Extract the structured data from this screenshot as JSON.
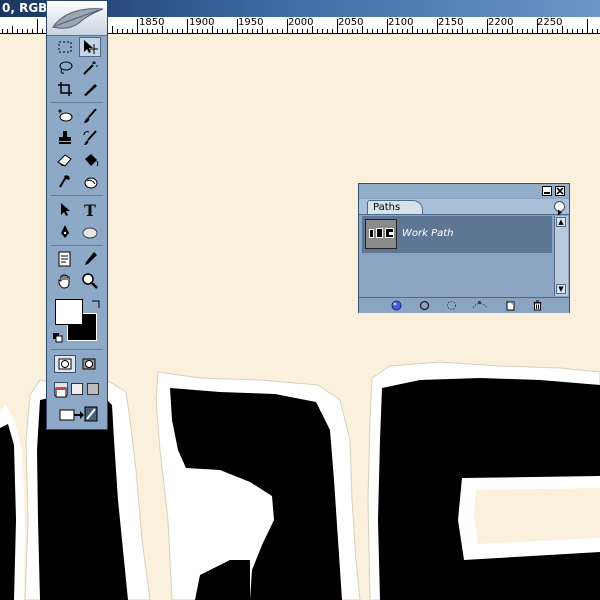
{
  "window": {
    "title": "0, RGB/"
  },
  "ruler": {
    "labels": [
      "1850",
      "1900",
      "1950",
      "2000",
      "2050",
      "2100",
      "2150",
      "2200",
      "2250"
    ]
  },
  "toolbox": {
    "tools": [
      {
        "id": "marquee",
        "icon": "marquee-icon"
      },
      {
        "id": "move",
        "icon": "move-icon"
      },
      {
        "id": "lasso",
        "icon": "lasso-icon"
      },
      {
        "id": "magic-wand",
        "icon": "magic-wand-icon"
      },
      {
        "id": "crop",
        "icon": "crop-icon"
      },
      {
        "id": "slice",
        "icon": "slice-icon"
      },
      {
        "id": "healing",
        "icon": "healing-brush-icon"
      },
      {
        "id": "brush",
        "icon": "brush-icon"
      },
      {
        "id": "stamp",
        "icon": "clone-stamp-icon"
      },
      {
        "id": "history-brush",
        "icon": "history-brush-icon"
      },
      {
        "id": "eraser",
        "icon": "eraser-icon"
      },
      {
        "id": "bucket",
        "icon": "paint-bucket-icon"
      },
      {
        "id": "dodge",
        "icon": "dodge-icon"
      },
      {
        "id": "blur",
        "icon": "blur-icon"
      },
      {
        "id": "path-select",
        "icon": "path-selection-icon"
      },
      {
        "id": "type",
        "icon": "type-icon",
        "glyph": "T"
      },
      {
        "id": "pen",
        "icon": "pen-icon"
      },
      {
        "id": "ellipse",
        "icon": "ellipse-icon"
      },
      {
        "id": "notes",
        "icon": "notes-icon"
      },
      {
        "id": "eyedropper",
        "icon": "eyedropper-icon"
      },
      {
        "id": "hand",
        "icon": "hand-icon"
      },
      {
        "id": "zoom",
        "icon": "zoom-icon"
      }
    ]
  },
  "colors": {
    "foreground": "#ffffff",
    "background": "#000000",
    "canvas": "#fbf0dc",
    "panel": "#8aa4c2"
  },
  "paths_panel": {
    "tab": "Paths",
    "items": [
      {
        "name": "Work Path"
      }
    ],
    "footer_icons": [
      "fill-path-icon",
      "stroke-path-icon",
      "load-selection-icon",
      "make-path-icon",
      "new-path-icon",
      "delete-path-icon"
    ]
  }
}
